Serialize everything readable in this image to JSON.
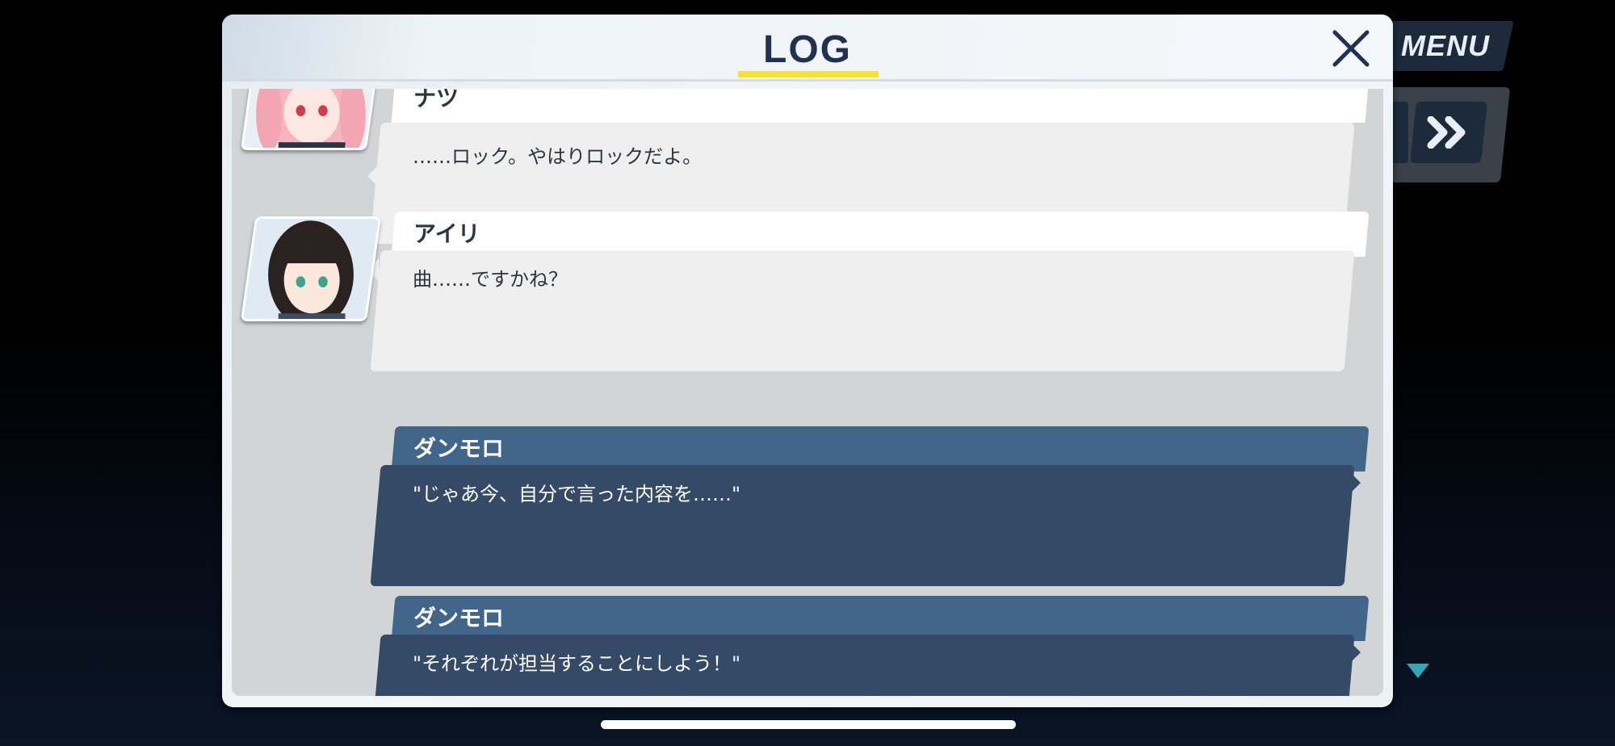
{
  "hud": {
    "menu_label": "MENU",
    "fast_forward_icon": "double-chevron-right-icon"
  },
  "log": {
    "title": "LOG",
    "close_icon": "close-icon",
    "entries": [
      {
        "speaker": "ナツ",
        "text": "……ロック。やはりロックだよ。",
        "style": "light",
        "avatar": "pink-hair-girl"
      },
      {
        "speaker": "アイリ",
        "text": "曲……ですかね？",
        "style": "light",
        "avatar": "black-hair-girl"
      },
      {
        "speaker": "ダンモロ",
        "text": "\"じゃあ今、自分で言った内容を……\"",
        "style": "dark",
        "avatar": ""
      },
      {
        "speaker": "ダンモロ",
        "text": "\"それぞれが担当することにしよう！\"",
        "style": "dark",
        "avatar": ""
      }
    ]
  },
  "colors": {
    "accent_underline": "#f7e22d",
    "title_text": "#1f3350",
    "dark_name_bar": "#42658a",
    "dark_message_box": "#344a66",
    "scroll_indicator": "#2fa9b8"
  }
}
